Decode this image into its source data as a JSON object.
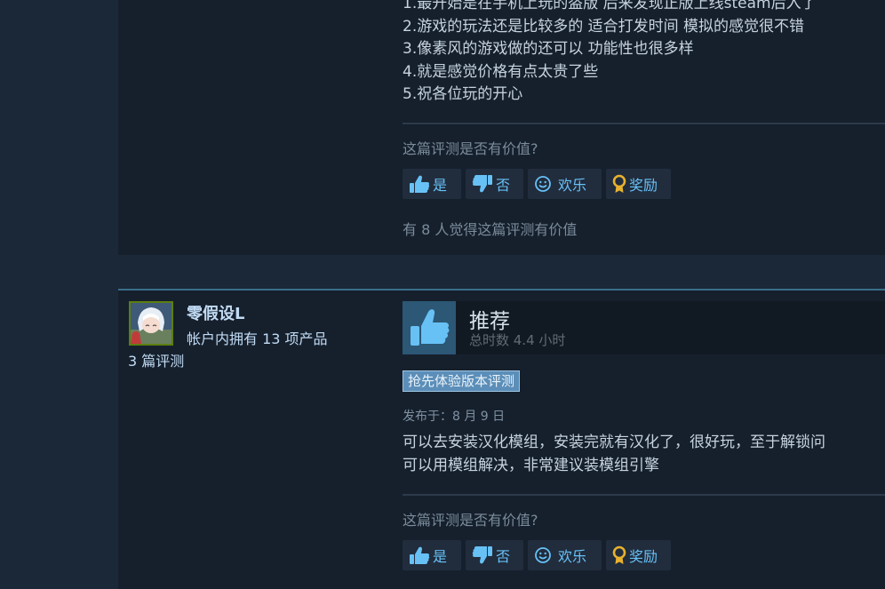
{
  "review1": {
    "lines": [
      "1.最开始是在手机上玩的盗版 后来发现正版上线steam后入了",
      "2.游戏的玩法还是比较多的 适合打发时间 模拟的感觉很不错",
      "3.像素风的游戏做的还可以 功能性也很多样",
      "4.就是感觉价格有点太贵了些",
      "5.祝各位玩的开心"
    ],
    "helpful_prompt": "这篇评测是否有价值?",
    "vote_yes_label": "是",
    "vote_no_label": "否",
    "vote_funny_label": "欢乐",
    "vote_award_label": "奖励",
    "helpful_count": "有 8 人觉得这篇评测有价值"
  },
  "review2": {
    "author": {
      "name": "零假设L",
      "products": "帐户内拥有 13 项产品",
      "reviews": "3 篇评测"
    },
    "recommendation": "推荐",
    "hours": "总时数 4.4 小时",
    "badge": "抢先体验版本评测",
    "posted": "发布于：8 月 9 日",
    "lines": [
      "可以去安装汉化模组，安装完就有汉化了，很好玩，至于解锁问",
      "可以用模组解决，非常建议装模组引擎"
    ],
    "helpful_prompt": "这篇评测是否有价值?",
    "vote_yes_label": "是",
    "vote_no_label": "否",
    "vote_funny_label": "欢乐",
    "vote_award_label": "奖励"
  },
  "icons": {
    "thumbs_up": "thumbs-up-icon",
    "thumbs_down": "thumbs-down-icon",
    "funny": "smiley-icon",
    "award": "award-ribbon-icon"
  },
  "colors": {
    "page_bg": "#1b2838",
    "card_bg": "#16202d",
    "link_blue": "#67c1f5",
    "badge_blue": "#5b8eb8",
    "award_gold": "#e7b22e",
    "avatar_border": "#5c7e10"
  }
}
